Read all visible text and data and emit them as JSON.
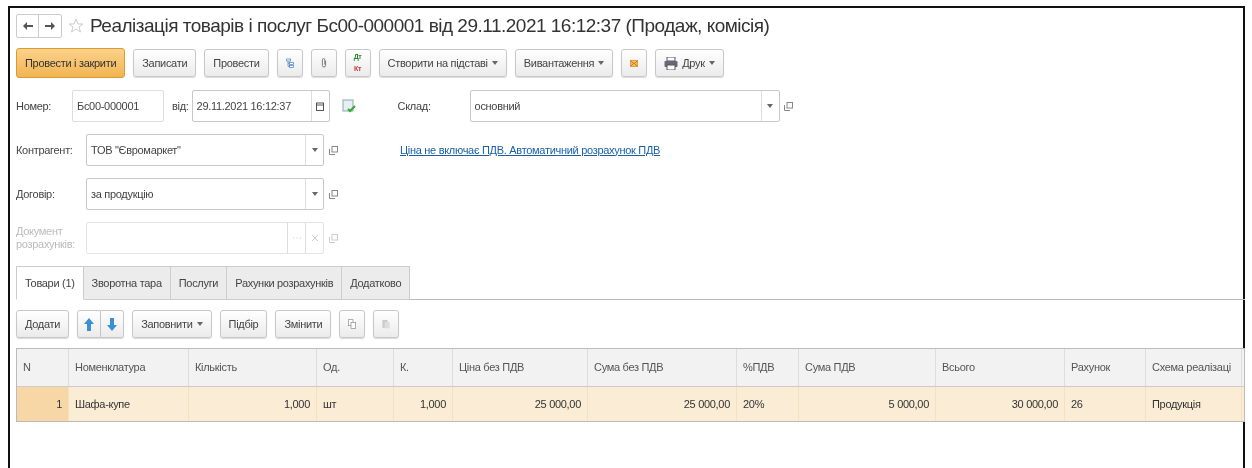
{
  "window": {
    "title": "Реалізація товарів і послуг Бс00-000001 від 29.11.2021 16:12:37 (Продаж, комісія)",
    "favorite": false
  },
  "toolbar": [
    {
      "kind": "primary",
      "label": "Провести і закрити"
    },
    {
      "kind": "button",
      "label": "Записати"
    },
    {
      "kind": "button",
      "label": "Провести"
    },
    {
      "kind": "structure"
    },
    {
      "kind": "attach"
    },
    {
      "kind": "dtkt",
      "top": "Дт",
      "bottom": "Кт"
    },
    {
      "kind": "menu",
      "label": "Створити на підставі"
    },
    {
      "kind": "menu",
      "label": "Вивантаження"
    },
    {
      "kind": "mail"
    },
    {
      "kind": "print",
      "label": "Друк"
    }
  ],
  "header": {
    "number_label": "Номер:",
    "number": "Бс00-000001",
    "date_label": "від:",
    "date": "29.11.2021 16:12:37",
    "warehouse_label": "Склад:",
    "warehouse": "основний",
    "vat_link": "Ціна не включає ПДВ. Автоматичний розрахунок ПДВ"
  },
  "fields": [
    {
      "label": "Контрагент:",
      "value": "ТОВ \"Євромаркет\"",
      "disabled": false
    },
    {
      "label": "Договір:",
      "value": "за продукцію",
      "disabled": false
    },
    {
      "label": "Документ розрахунків:",
      "disabled": true
    }
  ],
  "tabs": [
    {
      "label": "Товари (1)",
      "selected": true
    },
    {
      "label": "Зворотна тара",
      "selected": false
    },
    {
      "label": "Послуги",
      "selected": false
    },
    {
      "label": "Рахунки розрахунків",
      "selected": false
    },
    {
      "label": "Додатково",
      "selected": false
    }
  ],
  "table_toolbar": [
    {
      "kind": "button",
      "label": "Додати"
    },
    {
      "kind": "arrows"
    },
    {
      "kind": "menu",
      "label": "Заповнити"
    },
    {
      "kind": "button",
      "label": "Підбір"
    },
    {
      "kind": "button",
      "label": "Змінити"
    },
    {
      "kind": "copy"
    },
    {
      "kind": "paste",
      "disabled": true
    }
  ],
  "table": {
    "columns": [
      {
        "label": "N",
        "kind": "number"
      },
      {
        "label": "Номенклатура",
        "kind": "text"
      },
      {
        "label": "Кількість",
        "kind": "number"
      },
      {
        "label": "Од.",
        "kind": "text"
      },
      {
        "label": "К.",
        "kind": "number"
      },
      {
        "label": "Ціна без ПДВ",
        "kind": "number"
      },
      {
        "label": "Сума без ПДВ",
        "kind": "number"
      },
      {
        "label": "%ПДВ",
        "kind": "text"
      },
      {
        "label": "Сума ПДВ",
        "kind": "number"
      },
      {
        "label": "Всього",
        "kind": "number"
      },
      {
        "label": "Рахунок",
        "kind": "text"
      },
      {
        "label": "Схема реалізаці",
        "kind": "text"
      }
    ],
    "rows": [
      {
        "selected": true,
        "cells": [
          "1",
          "Шафа-купе",
          "1,000",
          "шт",
          "1,000",
          "25 000,00",
          "25 000,00",
          "20%",
          "5 000,00",
          "30 000,00",
          "26",
          "Продукція"
        ]
      }
    ]
  }
}
